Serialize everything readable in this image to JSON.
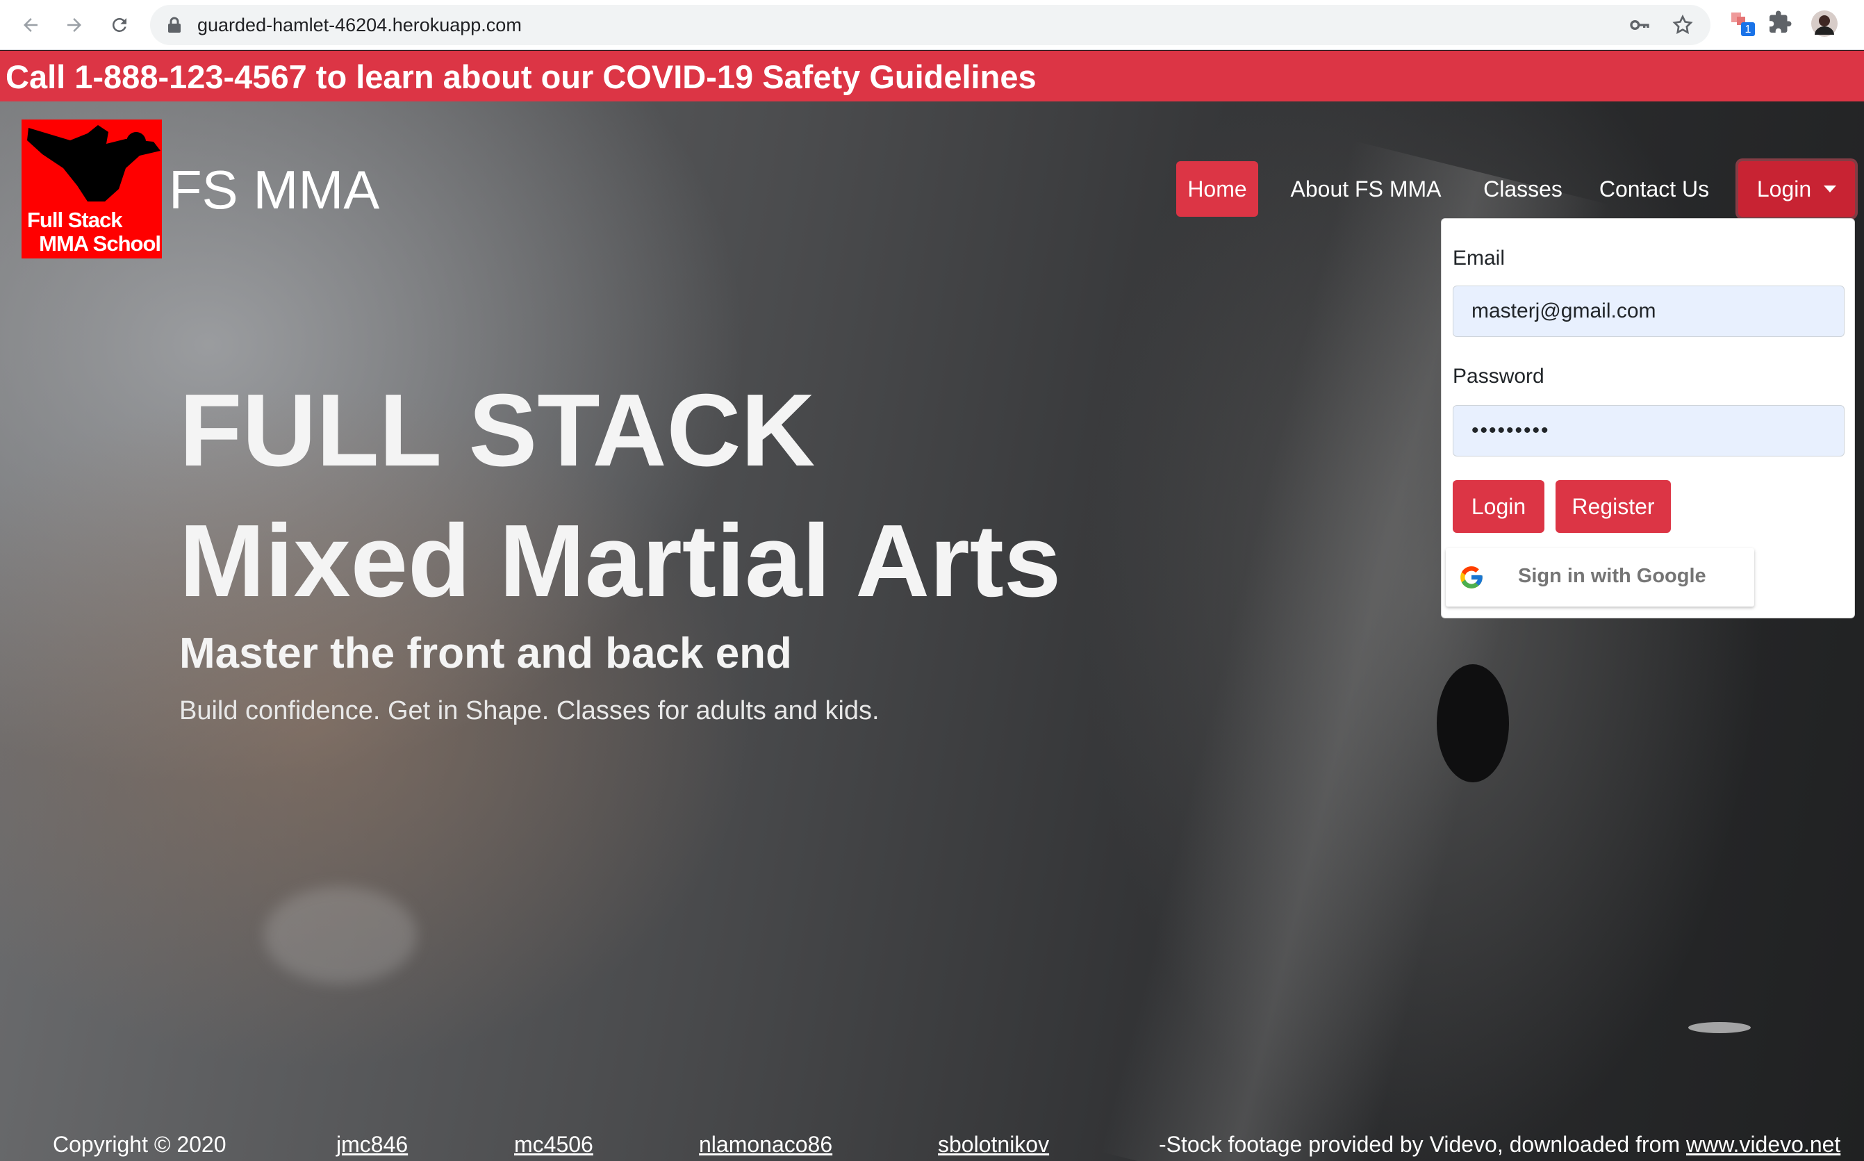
{
  "browser": {
    "url": "guarded-hamlet-46204.herokuapp.com",
    "extension_badge": "1"
  },
  "alert": {
    "text": "Call 1-888-123-4567 to learn about our COVID-19 Safety Guidelines"
  },
  "navbar": {
    "logo": {
      "line1": "Full Stack",
      "line2": "MMA School"
    },
    "brand": "FS MMA",
    "items": [
      {
        "label": "Home",
        "active": true
      },
      {
        "label": "About FS MMA"
      },
      {
        "label": "Classes"
      },
      {
        "label": "Contact Us"
      },
      {
        "label": "Login",
        "dropdown_open": true
      }
    ]
  },
  "login_form": {
    "email_label": "Email",
    "email_value": "masterj@gmail.com",
    "password_label": "Password",
    "password_value": "•••••••••",
    "login_button": "Login",
    "register_button": "Register",
    "google_button": "Sign in with Google"
  },
  "hero": {
    "title_line1": "FULL STACK",
    "title_line2": "Mixed Martial Arts",
    "subtitle": "Master the front and back end",
    "lead": "Build confidence. Get in Shape. Classes for adults and kids."
  },
  "footer": {
    "copyright": "Copyright © 2020",
    "authors": [
      "jmc846",
      "mc4506",
      "nlamonaco86",
      "sbolotnikov"
    ],
    "credit_prefix": "-Stock footage provided by Videvo, downloaded from ",
    "credit_link": "www.videvo.net"
  },
  "colors": {
    "accent": "#dc3545",
    "accent_dark": "#c82333",
    "input_autofill": "#e8f0fe"
  }
}
